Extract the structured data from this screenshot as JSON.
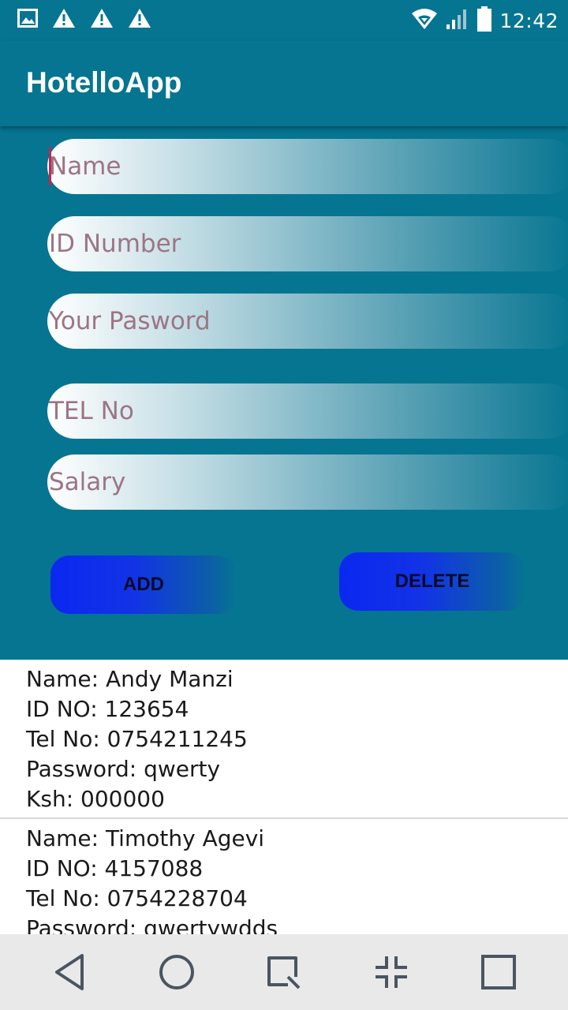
{
  "status_bar": {
    "left_icons": [
      "image-icon",
      "warning-icon",
      "warning-icon",
      "warning-icon"
    ],
    "right_icons": [
      "wifi-icon",
      "signal-icon",
      "battery-icon"
    ],
    "time": "12:42"
  },
  "app_bar": {
    "title": "HotelloApp"
  },
  "form": {
    "name_placeholder": "Name",
    "id_placeholder": "ID Number",
    "password_placeholder": "Your Pasword",
    "tel_placeholder": "TEL No",
    "salary_placeholder": "Salary",
    "add_label": "ADD",
    "delete_label": "DELETE"
  },
  "records": [
    {
      "name": "Name: Andy Manzi",
      "id": "ID NO: 123654",
      "tel": "Tel No: 0754211245",
      "password": "Password: qwerty",
      "salary": "Ksh: 000000"
    },
    {
      "name": "Name: Timothy Agevi",
      "id": "ID NO: 4157088",
      "tel": "Tel No: 0754228704",
      "password": "Password: qwertywdds",
      "salary": ""
    }
  ],
  "nav_bar": {
    "icons": [
      "back-icon",
      "home-icon",
      "recents-icon",
      "collapse-icon",
      "square-icon"
    ]
  },
  "colors": {
    "primary": "#067591",
    "button": "#0a28f0",
    "placeholder": "#9c7585"
  }
}
